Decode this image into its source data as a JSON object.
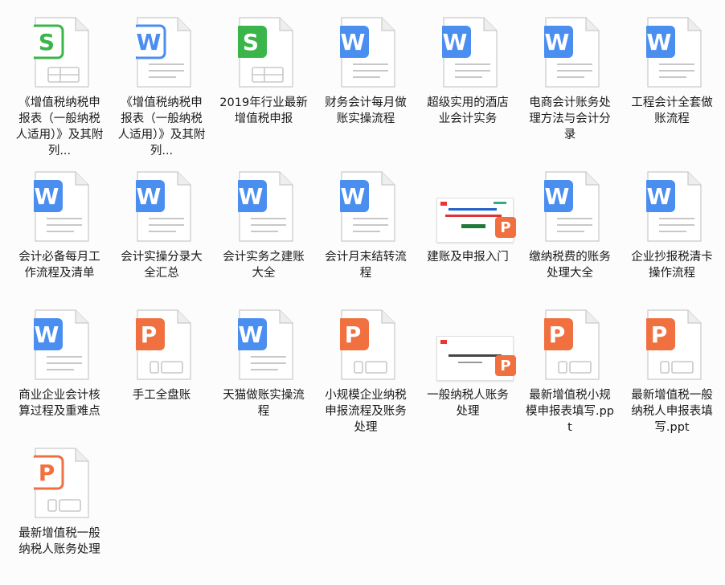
{
  "colors": {
    "word": "#4a8ef0",
    "excel": "#3ab54a",
    "ppt": "#f07040",
    "page": "#ffffff"
  },
  "files": [
    {
      "label": "《增值税纳税申报表（一般纳税人适用）》及其附列...",
      "type": "excel-outline",
      "icon": "spreadsheet-icon"
    },
    {
      "label": "《增值税纳税申报表（一般纳税人适用）》及其附列...",
      "type": "word-outline",
      "icon": "word-doc-icon"
    },
    {
      "label": "2019年行业最新增值税申报",
      "type": "excel",
      "icon": "spreadsheet-icon"
    },
    {
      "label": "财务会计每月做账实操流程",
      "type": "word",
      "icon": "word-doc-icon"
    },
    {
      "label": "超级实用的酒店业会计实务",
      "type": "word",
      "icon": "word-doc-icon"
    },
    {
      "label": "电商会计账务处理方法与会计分录",
      "type": "word",
      "icon": "word-doc-icon"
    },
    {
      "label": "工程会计全套做账流程",
      "type": "word",
      "icon": "word-doc-icon"
    },
    {
      "label": "会计必备每月工作流程及清单",
      "type": "word",
      "icon": "word-doc-icon"
    },
    {
      "label": "会计实操分录大全汇总",
      "type": "word",
      "icon": "word-doc-icon"
    },
    {
      "label": "会计实务之建账大全",
      "type": "word",
      "icon": "word-doc-icon"
    },
    {
      "label": "会计月末结转流程",
      "type": "word",
      "icon": "word-doc-icon"
    },
    {
      "label": "建账及申报入门",
      "type": "thumb1",
      "icon": "presentation-thumbnail-icon"
    },
    {
      "label": "缴纳税费的账务处理大全",
      "type": "word",
      "icon": "word-doc-icon"
    },
    {
      "label": "企业抄报税清卡操作流程",
      "type": "word",
      "icon": "word-doc-icon"
    },
    {
      "label": "商业企业会计核算过程及重难点",
      "type": "word",
      "icon": "word-doc-icon"
    },
    {
      "label": "手工全盘账",
      "type": "ppt",
      "icon": "ppt-doc-icon"
    },
    {
      "label": "天猫做账实操流程",
      "type": "word",
      "icon": "word-doc-icon"
    },
    {
      "label": "小规模企业纳税申报流程及账务处理",
      "type": "ppt",
      "icon": "ppt-doc-icon"
    },
    {
      "label": "一般纳税人账务处理",
      "type": "thumb2",
      "icon": "presentation-thumbnail-icon"
    },
    {
      "label": "最新增值税小规模申报表填写.ppt",
      "type": "ppt",
      "icon": "ppt-doc-icon"
    },
    {
      "label": "最新增值税一般纳税人申报表填写.ppt",
      "type": "ppt",
      "icon": "ppt-doc-icon"
    },
    {
      "label": "最新增值税一般纳税人账务处理",
      "type": "ppt-outline",
      "icon": "ppt-doc-icon"
    }
  ]
}
